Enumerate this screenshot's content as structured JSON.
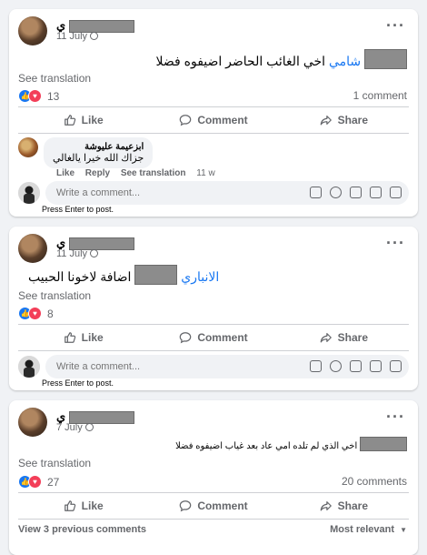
{
  "posts": [
    {
      "author_suffix": "ي",
      "date": "11 July",
      "text_highlight": "شامي",
      "text_rest": "اخي الغائب الحاضر اضيفوه فضلا",
      "see_translation": "See translation",
      "reaction_count": "13",
      "comment_count": "1 comment",
      "actions": {
        "like": "Like",
        "comment": "Comment",
        "share": "Share"
      },
      "comment": {
        "author": "ابزعيمة عليوشة",
        "text": "جزاك الله خيرا يالغالي",
        "like": "Like",
        "reply": "Reply",
        "see_translation": "See translation",
        "time": "11 w"
      },
      "write_placeholder": "Write a comment...",
      "press_enter": "Press Enter to post."
    },
    {
      "author_suffix": "ي",
      "date": "11 July",
      "text_highlight": "الانباري",
      "text_rest": "اضافة لاخونا الحبيب",
      "see_translation": "See translation",
      "reaction_count": "8",
      "actions": {
        "like": "Like",
        "comment": "Comment",
        "share": "Share"
      },
      "write_placeholder": "Write a comment...",
      "press_enter": "Press Enter to post."
    },
    {
      "author_suffix": "ي",
      "date": "7 July",
      "text": "اخي الذي لم تلده امي عاد بعد غياب اضيفوه فضلا",
      "see_translation": "See translation",
      "reaction_count": "27",
      "comment_count": "20 comments",
      "actions": {
        "like": "Like",
        "comment": "Comment",
        "share": "Share"
      },
      "view_previous": "View 3 previous comments",
      "sort": "Most relevant"
    }
  ],
  "icons": {
    "more": "more-horiz-icon",
    "globe": "globe-icon",
    "like": "thumb-up-icon",
    "comment": "speech-bubble-icon",
    "share": "share-arrow-icon"
  },
  "write_icons": [
    "sticker-icon",
    "emoji-icon",
    "camera-icon",
    "gif-icon",
    "sticker-2-icon"
  ],
  "colors": {
    "accent": "#1877f2",
    "love": "#f33e58",
    "muted": "#65676b",
    "bg": "#f0f2f5"
  }
}
